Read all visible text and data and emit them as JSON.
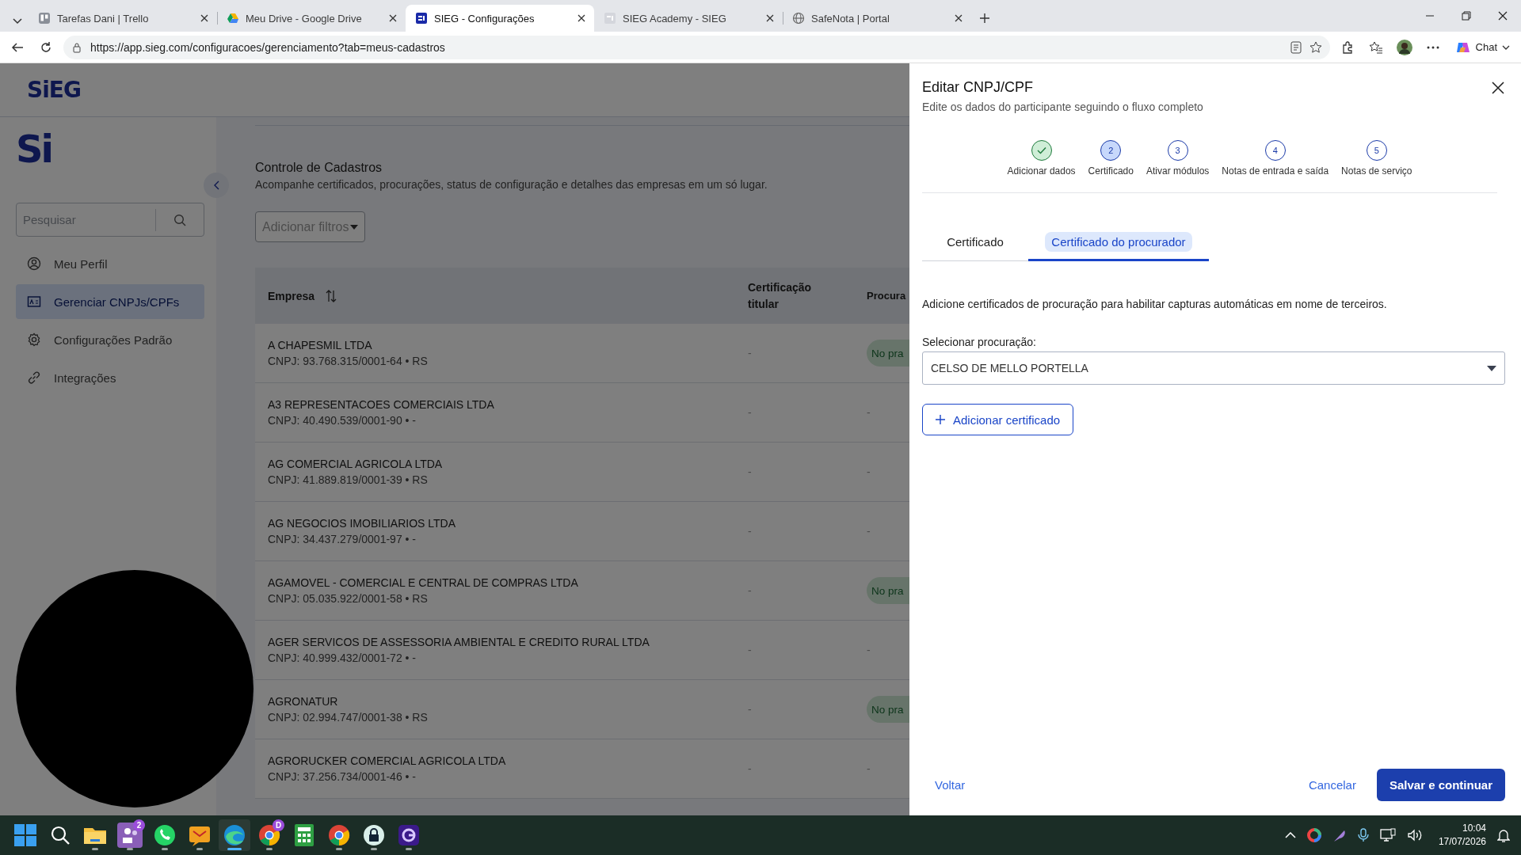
{
  "browser": {
    "tabs": [
      {
        "title": "Tarefas Dani | Trello",
        "selected": false
      },
      {
        "title": "Meu Drive - Google Drive",
        "selected": false
      },
      {
        "title": "SIEG - Configurações",
        "selected": true
      },
      {
        "title": "SIEG Academy - SIEG",
        "selected": false
      },
      {
        "title": "SafeNota | Portal",
        "selected": false
      }
    ],
    "url": "https://app.sieg.com/configuracoes/gerenciamento?tab=meus-cadastros",
    "chat_label": "Chat"
  },
  "app": {
    "header_logo": "SiEG",
    "sidebar": {
      "logo": "Si",
      "search_placeholder": "Pesquisar",
      "items": [
        {
          "label": "Meu Perfil",
          "selected": false
        },
        {
          "label": "Gerenciar CNPJs/CPFs",
          "selected": true
        },
        {
          "label": "Configurações Padrão",
          "selected": false
        },
        {
          "label": "Integrações",
          "selected": false
        }
      ]
    },
    "main": {
      "title": "Controle de Cadastros",
      "subtitle": "Acompanhe certificados, procurações, status de configuração e detalhes das empresas em um só lugar.",
      "filter_button": "Adicionar filtros",
      "table": {
        "columns": [
          "Empresa",
          "Certificação titular",
          "Procura"
        ],
        "rows": [
          {
            "name": "A CHAPESMIL LTDA",
            "detail": "CNPJ: 93.768.315/0001-64 • RS",
            "certificate": "-",
            "proxy": {
              "kind": "badge",
              "text": "No pra"
            }
          },
          {
            "name": "A3 REPRESENTACOES COMERCIAIS LTDA",
            "detail": "CNPJ: 40.490.539/0001-90 • -",
            "certificate": "-",
            "proxy": {
              "kind": "text",
              "text": "-"
            }
          },
          {
            "name": "AG COMERCIAL AGRICOLA LTDA",
            "detail": "CNPJ: 41.889.819/0001-39 • RS",
            "certificate": "-",
            "proxy": {
              "kind": "text",
              "text": "-"
            }
          },
          {
            "name": "AG NEGOCIOS IMOBILIARIOS LTDA",
            "detail": "CNPJ: 34.437.279/0001-97 • -",
            "certificate": "-",
            "proxy": {
              "kind": "text",
              "text": "-"
            }
          },
          {
            "name": "AGAMOVEL - COMERCIAL E CENTRAL DE COMPRAS LTDA",
            "detail": "CNPJ: 05.035.922/0001-58 • RS",
            "certificate": "-",
            "proxy": {
              "kind": "badge",
              "text": "No pra"
            }
          },
          {
            "name": "AGER SERVICOS DE ASSESSORIA AMBIENTAL E CREDITO RURAL LTDA",
            "detail": "CNPJ: 40.999.432/0001-72 • -",
            "certificate": "-",
            "proxy": {
              "kind": "text",
              "text": "-"
            }
          },
          {
            "name": "AGRONATUR",
            "detail": "CNPJ: 02.994.747/0001-38 • RS",
            "certificate": "-",
            "proxy": {
              "kind": "badge",
              "text": "No pra"
            }
          },
          {
            "name": "AGRORUCKER COMERCIAL AGRICOLA LTDA",
            "detail": "CNPJ: 37.256.734/0001-46 • -",
            "certificate": "-",
            "proxy": {
              "kind": "text",
              "text": "-"
            }
          }
        ]
      }
    }
  },
  "panel": {
    "title": "Editar CNPJ/CPF",
    "subtitle": "Edite os dados do participante seguindo o fluxo completo",
    "steps": [
      {
        "label": "Adicionar dados",
        "kind": "done"
      },
      {
        "number": "2",
        "label": "Certificado",
        "kind": "current"
      },
      {
        "number": "3",
        "label": "Ativar módulos",
        "kind": "pending"
      },
      {
        "number": "4",
        "label": "Notas de entrada e saída",
        "kind": "pending"
      },
      {
        "number": "5",
        "label": "Notas de serviço",
        "kind": "pending"
      }
    ],
    "tabs": [
      {
        "label": "Certificado",
        "selected": false
      },
      {
        "label": "Certificado do procurador",
        "selected": true
      }
    ],
    "description": "Adicione certificados de procuração para habilitar capturas automáticas em nome de terceiros.",
    "select_label": "Selecionar procuração:",
    "select_value": "CELSO DE MELLO PORTELLA",
    "add_button": "Adicionar certificado",
    "back_button": "Voltar",
    "cancel_button": "Cancelar",
    "save_button": "Salvar e continuar"
  },
  "taskbar": {
    "apps": [
      {
        "running": false,
        "selected": false
      },
      {
        "running": false,
        "selected": false
      },
      {
        "running": true,
        "selected": false
      },
      {
        "running": true,
        "selected": false,
        "badge": "2"
      },
      {
        "running": true,
        "selected": false
      },
      {
        "running": true,
        "selected": false
      },
      {
        "running": true,
        "selected": true
      },
      {
        "running": true,
        "selected": false,
        "badge": "D"
      },
      {
        "running": false,
        "selected": false
      },
      {
        "running": true,
        "selected": false
      },
      {
        "running": true,
        "selected": false
      },
      {
        "running": true,
        "selected": false
      }
    ],
    "time": "10:04",
    "date": "17/07/2026"
  }
}
